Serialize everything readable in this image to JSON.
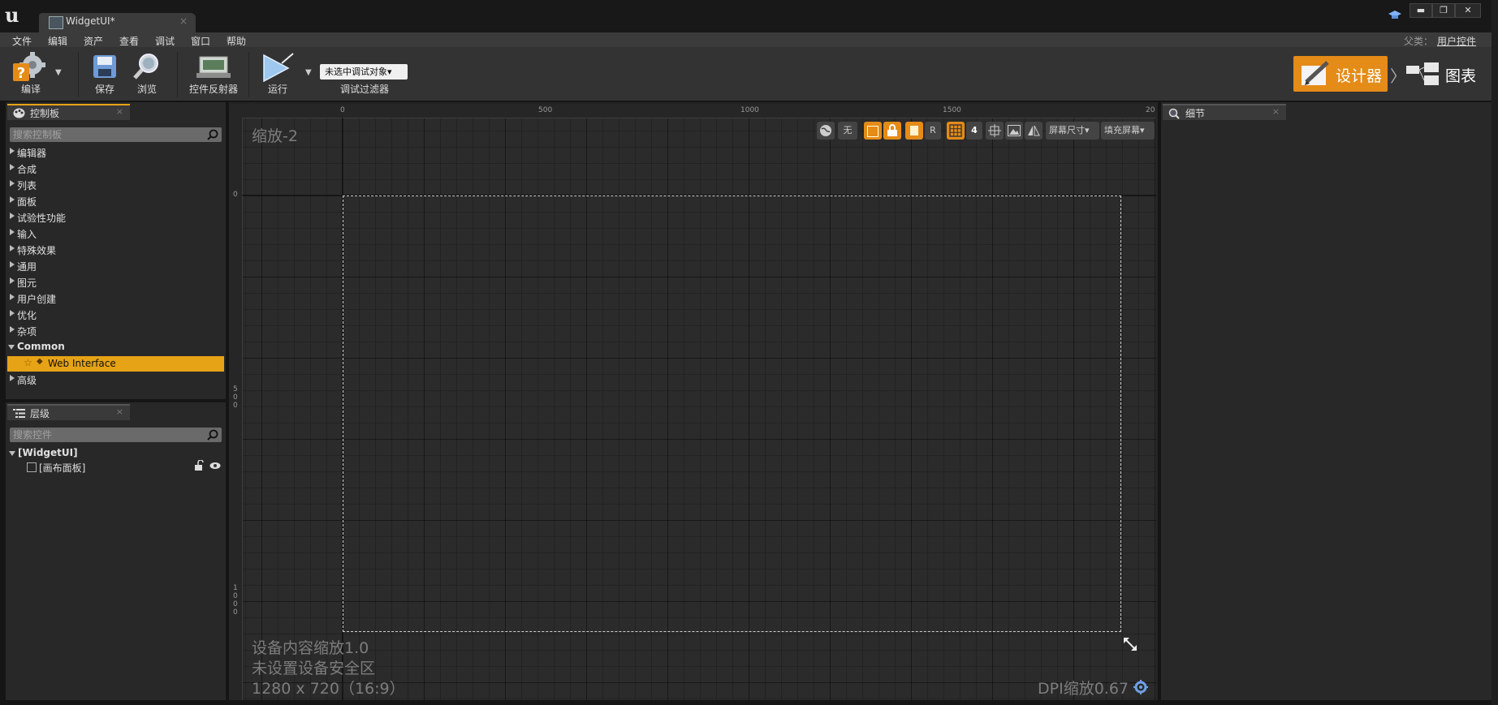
{
  "window": {
    "tab_title": "WidgetUI*",
    "tab_close": "×",
    "controls": {
      "minimize": "▬",
      "maximize": "❐",
      "close": "✕"
    }
  },
  "menu": {
    "items": [
      "文件",
      "编辑",
      "资产",
      "查看",
      "调试",
      "窗口",
      "帮助"
    ],
    "parent_label": "父类：",
    "parent_value": "用户控件"
  },
  "toolbar": {
    "compile": "编译",
    "save": "保存",
    "browse": "浏览",
    "widget_reflector": "控件反射器",
    "play": "运行",
    "debug_object": "未选中调试对象▾",
    "debug_filter": "调试过滤器",
    "designer": "设计器",
    "graph": "图表"
  },
  "palette": {
    "tab_label": "控制板",
    "tab_close": "×",
    "search_placeholder": "搜索控制板",
    "categories": [
      "编辑器",
      "合成",
      "列表",
      "面板",
      "试验性功能",
      "输入",
      "特殊效果",
      "通用",
      "图元",
      "用户创建",
      "优化",
      "杂项"
    ],
    "common_label": "Common",
    "selected_item": "Web Interface",
    "advanced_label": "高级"
  },
  "hierarchy": {
    "tab_label": "层级",
    "tab_close": "×",
    "search_placeholder": "搜索控件",
    "root": "[WidgetUI]",
    "child": "[画布面板]"
  },
  "details": {
    "tab_label": "细节",
    "tab_close": "×"
  },
  "canvas": {
    "zoom": "缩放-2",
    "ruler_top": [
      "0",
      "500",
      "1000",
      "1500",
      "20"
    ],
    "ruler_left": [
      "0",
      "5\n0\n0",
      "1\n0\n0\n0"
    ],
    "toolbar": {
      "none": "无",
      "r": "R",
      "grid_size": "4",
      "screen_size": "屏幕尺寸▾",
      "fill_screen": "填充屏幕▾"
    },
    "info_scale": "设备内容缩放1.0",
    "info_safe_zone": "未设置设备安全区",
    "info_resolution": "1280 x 720（16:9）",
    "dpi_scale": "DPI缩放0.67"
  },
  "colors": {
    "accent": "#e6a316",
    "designer_orange": "#e48b18",
    "selected_row": "#e6a316"
  }
}
